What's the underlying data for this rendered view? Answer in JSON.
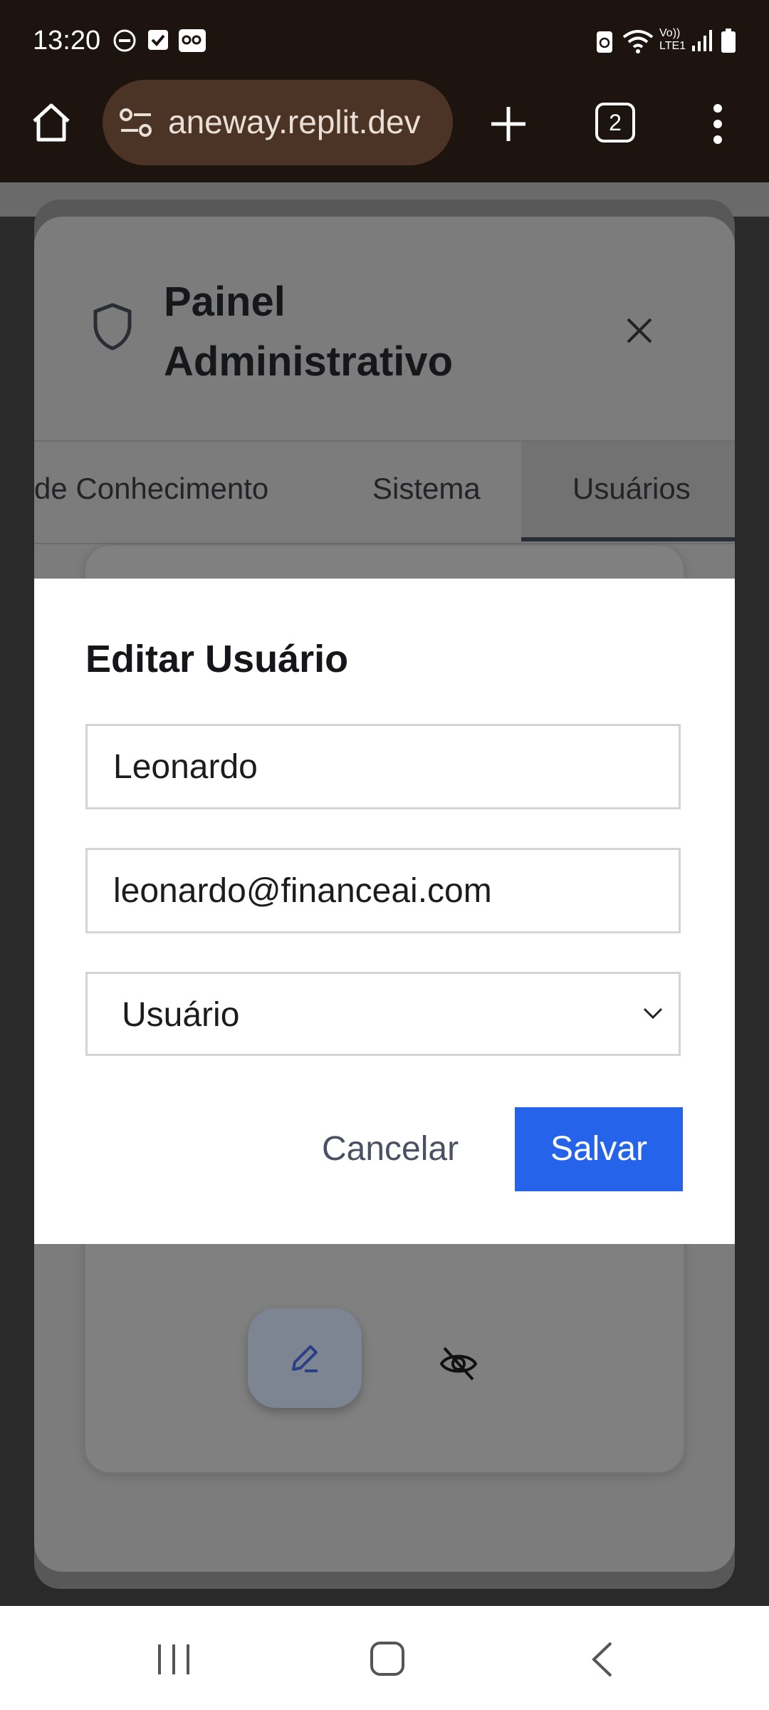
{
  "status_bar": {
    "time": "13:20",
    "icons": [
      "do-not-disturb-icon",
      "checkbox-icon",
      "voicemail-icon",
      "battery-saver-icon",
      "wifi-icon",
      "volte-icon",
      "signal-icon",
      "battery-icon"
    ],
    "volte_label": "Vo)) LTE1"
  },
  "browser": {
    "url": "aneway.replit.dev",
    "tab_count": "2"
  },
  "admin_panel": {
    "title": "Painel Administrativo",
    "tabs": [
      {
        "label": "de Conhecimento"
      },
      {
        "label": "Sistema"
      },
      {
        "label": "Usuários",
        "active": true
      }
    ]
  },
  "edit_user_modal": {
    "title": "Editar Usuário",
    "name_value": "Leonardo",
    "email_value": "leonardo@financeai.com",
    "role_selected": "Usuário",
    "cancel_label": "Cancelar",
    "save_label": "Salvar"
  },
  "colors": {
    "primary": "#2563eb",
    "browser_bar": "#1d1410",
    "url_pill": "#4b3426"
  }
}
